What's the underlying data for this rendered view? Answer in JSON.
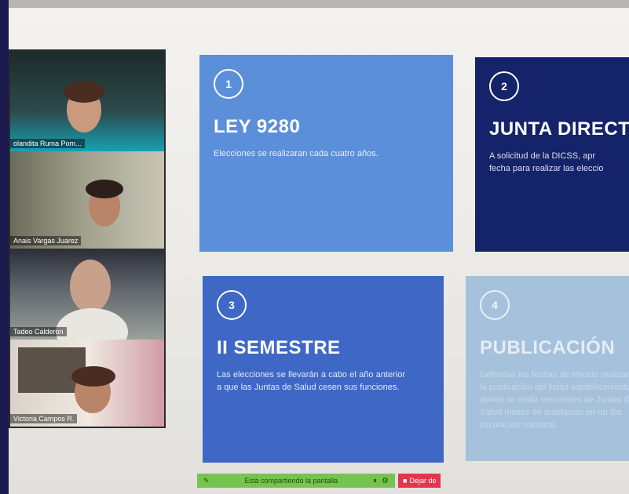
{
  "participants": [
    {
      "name": "olandita Ruma Pom..."
    },
    {
      "name": "Anais Vargas Juarez"
    },
    {
      "name": "Tadeo Calderon"
    },
    {
      "name": "Victoria Campos R."
    }
  ],
  "cards": [
    {
      "number": "1",
      "title": "LEY 9280",
      "body": "Elecciones se realizaran cada cuatro años.",
      "color": "#5b8fd9"
    },
    {
      "number": "2",
      "title": "JUNTA DIRECTI",
      "body_line1": "A solicitud de la DICSS, apr",
      "body_line2": "fecha para realizar las eleccio",
      "color": "#15236a"
    },
    {
      "number": "3",
      "title": "II SEMESTRE",
      "body": "Las elecciones se llevarán a cabo el año anterior a que las Juntas de Salud cesen sus funciones.",
      "color": "#3f68c6"
    },
    {
      "number": "4",
      "title": "PUBLICACIÓN",
      "body": "Definidas las fechas de eleccio realizará la publicación del listad establecimientos donde se realiz elecciones de Juntas de Salud meses de antelación en un dia circulación nacional.",
      "color": "#a6c1dc"
    }
  ],
  "share_bar": {
    "text": "Está compartiendo la pantalla",
    "stop_label": "Dejar de",
    "share_color": "#76c44e",
    "stop_color": "#e2354e"
  }
}
